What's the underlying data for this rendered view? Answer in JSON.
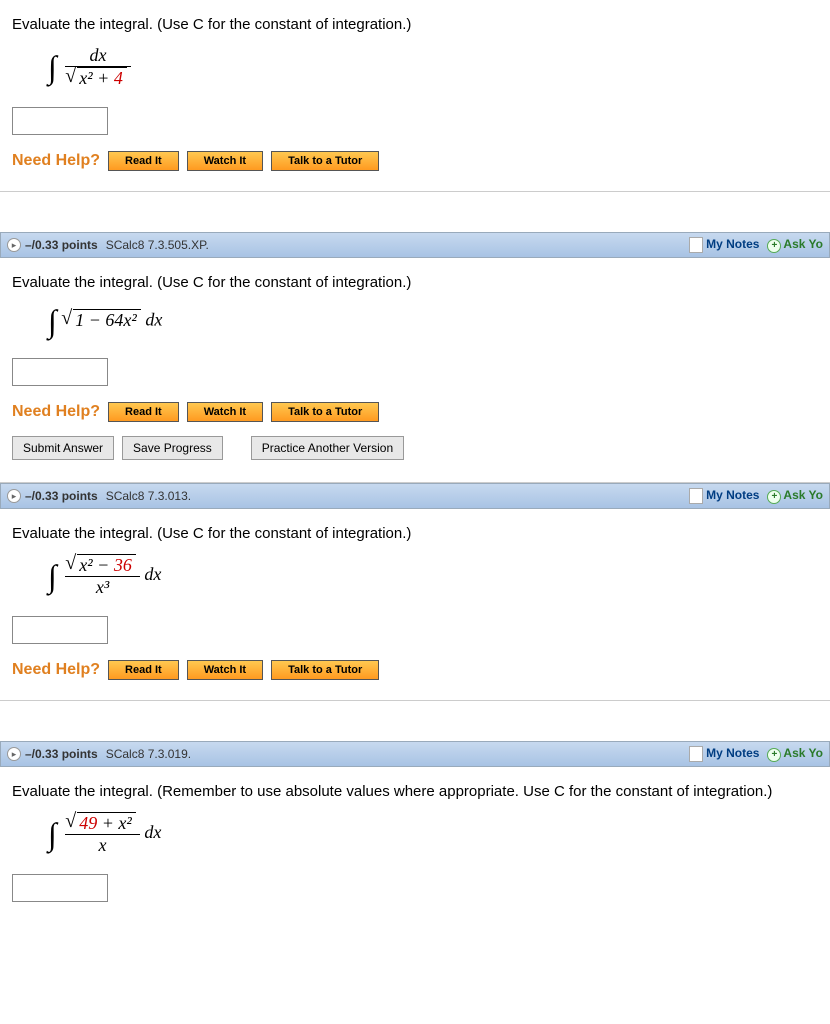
{
  "helpLabel": "Need Help?",
  "buttons": {
    "read": "Read It",
    "watch": "Watch It",
    "tutor": "Talk to a Tutor",
    "submit": "Submit Answer",
    "save": "Save Progress",
    "practice": "Practice Another Version"
  },
  "headerLinks": {
    "notes": "My Notes",
    "ask": "Ask Yo"
  },
  "q1": {
    "prompt": "Evaluate the integral. (Use C for the constant of integration.)",
    "integral_num": "dx",
    "integral_den_inner": "x² + ",
    "integral_den_red": "4"
  },
  "q2": {
    "points": "–/0.33 points",
    "source": "SCalc8 7.3.505.XP.",
    "prompt": "Evaluate the integral. (Use C for the constant of integration.)",
    "expr_inner": "1 − 64x²",
    "expr_suffix": " dx"
  },
  "q3": {
    "points": "–/0.33 points",
    "source": "SCalc8 7.3.013.",
    "prompt": "Evaluate the integral. (Use C for the constant of integration.)",
    "num_inner": "x² − ",
    "num_red": "36",
    "den": "x³",
    "suffix": " dx"
  },
  "q4": {
    "points": "–/0.33 points",
    "source": "SCalc8 7.3.019.",
    "prompt": "Evaluate the integral. (Remember to use absolute values where appropriate. Use C for the constant of integration.)",
    "num_red": "49",
    "num_rest": " + x²",
    "den": "x",
    "suffix": " dx"
  }
}
